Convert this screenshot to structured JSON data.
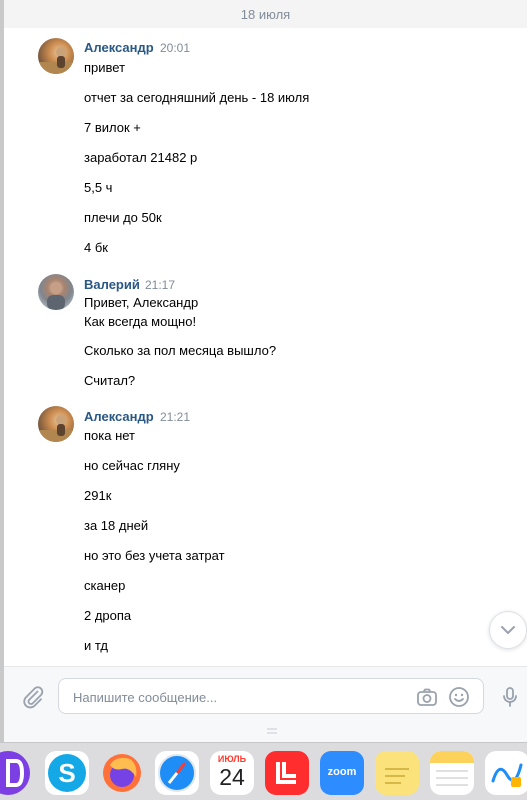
{
  "date_separator": "18 июля",
  "messages": [
    {
      "author": "Александр",
      "time": "20:01",
      "lines": [
        "привет",
        "отчет за сегодняшний день - 18 июля",
        "7 вилок +",
        "заработал 21482 р",
        "5,5 ч",
        "плечи до 50к",
        "4 бк"
      ]
    },
    {
      "author": "Валерий",
      "time": "21:17",
      "lines": [
        "Привет, Александр",
        "Как всегда мощно!",
        "Сколько за пол месяца вышло?",
        "Считал?"
      ]
    },
    {
      "author": "Александр",
      "time": "21:21",
      "lines": [
        "пока нет",
        "но сейчас гляну",
        "291к",
        "за 18 дней",
        "но это без учета затрат",
        "сканер",
        "2 дропа",
        "и тд"
      ]
    }
  ],
  "composer": {
    "placeholder": "Напишите сообщение..."
  },
  "dock": {
    "calendar_month": "ИЮЛЬ",
    "calendar_day": "24",
    "zoom_label": "zoom",
    "items": [
      "app-icon",
      "skype-icon",
      "firefox-icon",
      "safari-icon",
      "calendar-icon",
      "app-icon",
      "zoom-icon",
      "stickies-icon",
      "notes-icon",
      "freeform-icon"
    ]
  },
  "colors": {
    "author": "#2a5885",
    "meta": "#818c99",
    "composer_bg": "#f7f8fa",
    "dock_bg": "#dcdcdf"
  }
}
